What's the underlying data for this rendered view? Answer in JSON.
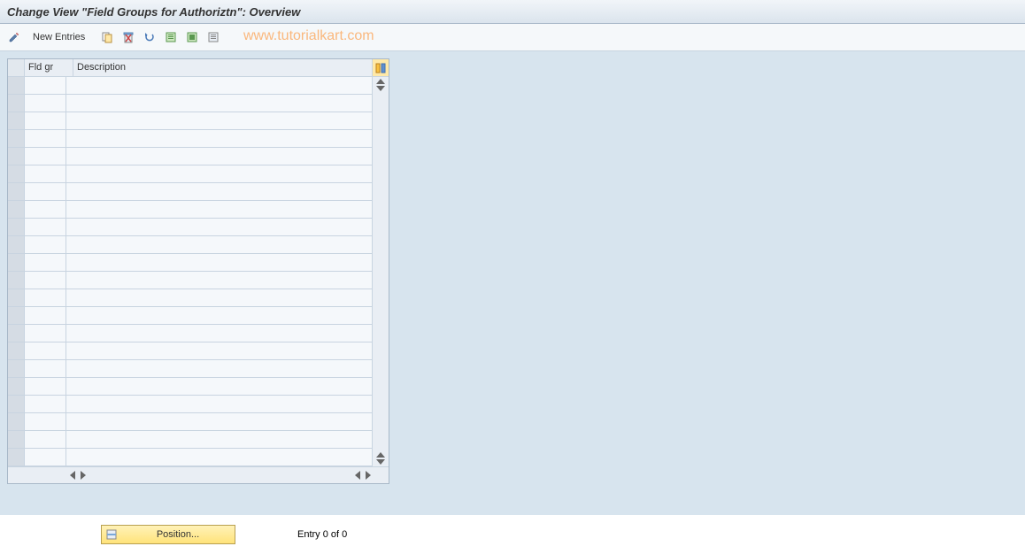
{
  "title": "Change View \"Field Groups for Authoriztn\": Overview",
  "toolbar": {
    "new_entries": "New Entries"
  },
  "watermark": "www.tutorialkart.com",
  "table": {
    "headers": {
      "fldgr": "Fld gr",
      "description": "Description"
    },
    "row_count": 22
  },
  "footer": {
    "position": "Position...",
    "entry": "Entry 0 of 0"
  }
}
